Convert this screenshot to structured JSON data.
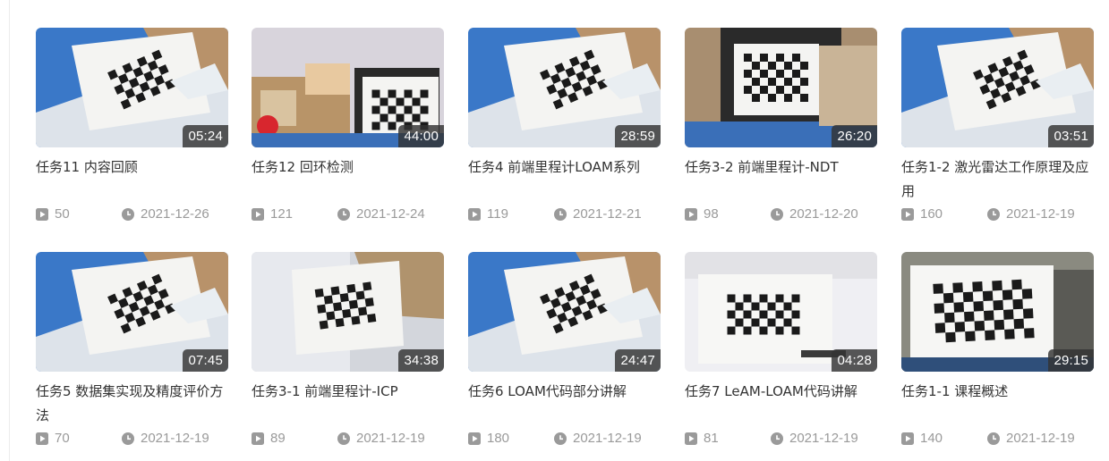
{
  "colors": {
    "meta_icon": "#9a9a9a",
    "title": "#333333",
    "duration_bg": "#333333"
  },
  "videos": [
    {
      "title": "任务11 内容回顾",
      "duration": "05:24",
      "views": "50",
      "date": "2021-12-26",
      "scene": "blue-tilted"
    },
    {
      "title": "任务12 回环检测",
      "duration": "44:00",
      "views": "121",
      "date": "2021-12-24",
      "scene": "boxes-monitor"
    },
    {
      "title": "任务4 前端里程计LOAM系列",
      "duration": "28:59",
      "views": "119",
      "date": "2021-12-21",
      "scene": "blue-tilted"
    },
    {
      "title": "任务3-2 前端里程计-NDT",
      "duration": "26:20",
      "views": "98",
      "date": "2021-12-20",
      "scene": "monitor-board"
    },
    {
      "title": "任务1-2 激光雷达工作原理及应用",
      "duration": "03:51",
      "views": "160",
      "date": "2021-12-19",
      "scene": "blue-tilted"
    },
    {
      "title": "任务5 数据集实现及精度评价方法",
      "duration": "07:45",
      "views": "70",
      "date": "2021-12-19",
      "scene": "blue-tilted"
    },
    {
      "title": "任务3-1 前端里程计-ICP",
      "duration": "34:38",
      "views": "89",
      "date": "2021-12-19",
      "scene": "white-tilted"
    },
    {
      "title": "任务6 LOAM代码部分讲解",
      "duration": "24:47",
      "views": "180",
      "date": "2021-12-19",
      "scene": "blue-tilted"
    },
    {
      "title": "任务7 LeAM-LOAM代码讲解",
      "duration": "04:28",
      "views": "81",
      "date": "2021-12-19",
      "scene": "white-wall"
    },
    {
      "title": "任务1-1 课程概述",
      "duration": "29:15",
      "views": "140",
      "date": "2021-12-19",
      "scene": "board-closeup"
    }
  ]
}
